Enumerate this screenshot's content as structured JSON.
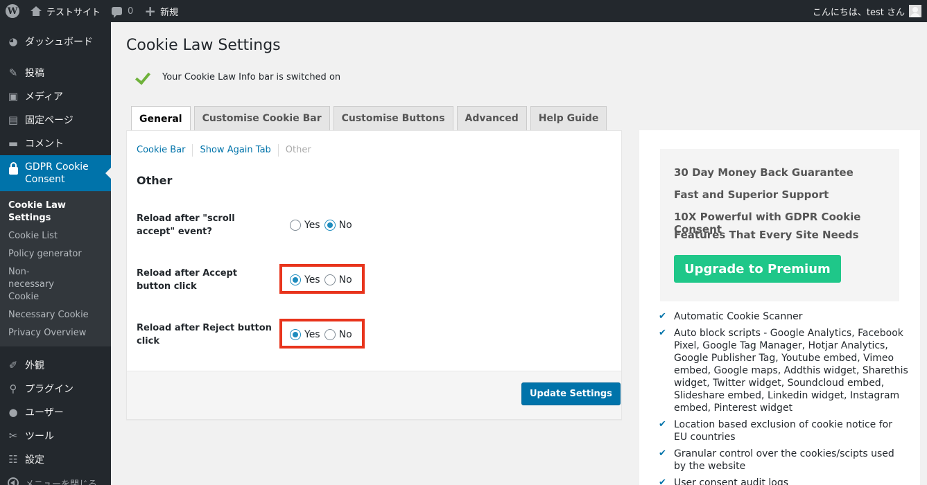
{
  "adminbar": {
    "site_name": "テストサイト",
    "comments_count": "0",
    "new_label": "新規",
    "greeting": "こんにちは、test さん"
  },
  "sidebar": {
    "items": [
      {
        "label": "ダッシュボード",
        "icon": "dashboard-icon"
      },
      {
        "label": "投稿",
        "icon": "pushpin-icon"
      },
      {
        "label": "メディア",
        "icon": "media-icon"
      },
      {
        "label": "固定ページ",
        "icon": "page-icon"
      },
      {
        "label": "コメント",
        "icon": "comment-icon"
      },
      {
        "label": "GDPR Cookie Consent",
        "icon": "lock-icon"
      },
      {
        "label": "外観",
        "icon": "brush-icon"
      },
      {
        "label": "プラグイン",
        "icon": "plugin-icon"
      },
      {
        "label": "ユーザー",
        "icon": "user-icon"
      },
      {
        "label": "ツール",
        "icon": "wrench-icon"
      },
      {
        "label": "設定",
        "icon": "settings-icon"
      },
      {
        "label": "メニューを閉じる",
        "icon": "collapse-icon"
      }
    ],
    "submenu": [
      "Cookie Law Settings",
      "Cookie List",
      "Policy generator",
      "Non-necessary Cookie",
      "Necessary Cookie",
      "Privacy Overview"
    ]
  },
  "main": {
    "title": "Cookie Law Settings",
    "notice": "Your Cookie Law Info bar is switched on",
    "tabs": [
      "General",
      "Customise Cookie Bar",
      "Customise Buttons",
      "Advanced",
      "Help Guide"
    ],
    "active_tab": "General",
    "subtabs": [
      "Cookie Bar",
      "Show Again Tab",
      "Other"
    ],
    "section_title": "Other",
    "settings": [
      {
        "label": "Reload after \"scroll accept\" event?",
        "yes": "Yes",
        "no": "No",
        "selected": "No"
      },
      {
        "label": "Reload after Accept button click",
        "yes": "Yes",
        "no": "No",
        "selected": "Yes"
      },
      {
        "label": "Reload after Reject button click",
        "yes": "Yes",
        "no": "No",
        "selected": "Yes"
      }
    ],
    "update_button": "Update Settings"
  },
  "promo": {
    "lines": [
      "30 Day Money Back Guarantee",
      "Fast and Superior Support",
      "10X Powerful with GDPR Cookie Consent",
      "Features That Every Site Needs"
    ],
    "upgrade_button": "Upgrade to Premium",
    "features": [
      "Automatic Cookie Scanner",
      "Auto block scripts - Google Analytics, Facebook Pixel, Google Tag Manager, Hotjar Analytics, Google Publisher Tag, Youtube embed, Vimeo embed, Google maps, Addthis widget, Sharethis widget, Twitter widget, Soundcloud embed, Slideshare embed, Linkedin widget, Instagram embed, Pinterest widget",
      "Location based exclusion of cookie notice for EU countries",
      "Granular control over the cookies/scipts used by the website",
      "User consent audit logs"
    ]
  },
  "colors": {
    "admin_dark": "#23282d",
    "accent_blue": "#0073aa",
    "upgrade_green": "#1fc789",
    "highlight_red": "#e8341c"
  }
}
